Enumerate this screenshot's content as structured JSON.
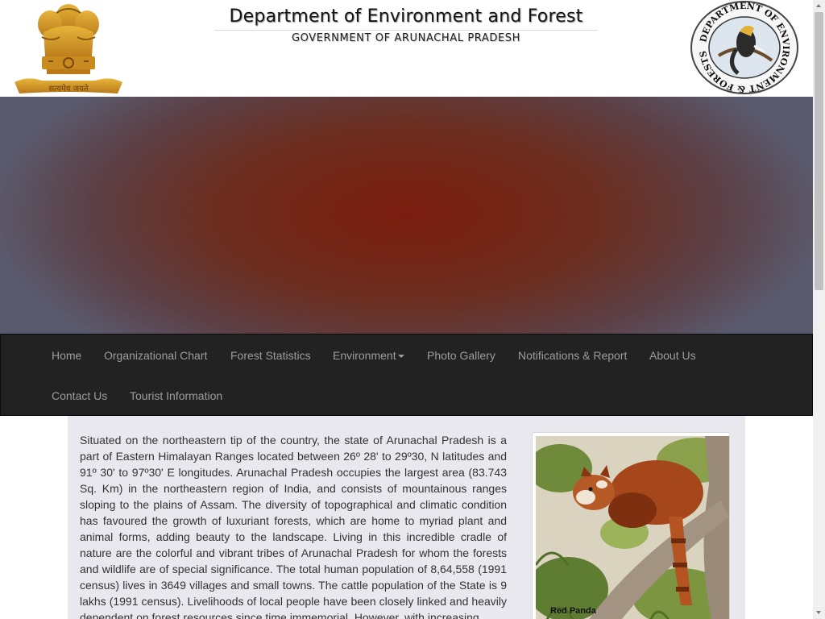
{
  "header": {
    "title": "Department of Environment and Forest",
    "subtitle": "GOVERNMENT OF ARUNACHAL PRADESH",
    "emblem_text": "सत्यमेव जयते",
    "seal_text": "DEPARTMENT OF ENVIRONMENT & FORESTS (AP)"
  },
  "nav": {
    "items": [
      {
        "label": "Home"
      },
      {
        "label": "Organizational Chart"
      },
      {
        "label": "Forest Statistics"
      },
      {
        "label": "Environment"
      },
      {
        "label": "Photo Gallery"
      },
      {
        "label": "Notifications & Report"
      },
      {
        "label": "About Us"
      },
      {
        "label": "Contact Us"
      },
      {
        "label": "Tourist Information"
      }
    ]
  },
  "content": {
    "intro": "Situated on the northeastern tip of the country, the state of Arunachal Pradesh is a part of Eastern Himalayan Ranges located between 26º 28' to 29º30, N latitudes and 91º 30' to 97º30' E longitudes. Arunachal Pradesh occupies the largest area (83.743 Sq. Km) in the northeastern region of India, and consists of mountainous ranges sloping to the plains of Assam. The diversity of topographical and climatic condition has favoured the growth of luxuriant forests, which are home to myriad plant and animal forms, adding beauty to the landscape. Living in this incredible cradle of nature are the colorful and vibrant tribes of Arunachal Pradesh for whom the forests and wildlife are of special significance. The total human population of 8,64,558 (1991 census) lives in 3649 villages and small towns. The cattle population of the State is 9 lakhs (1991 census). Livelihoods of local people have been closely linked and heavily dependent on forest resources since time immemorial. However, with increasing",
    "photo_caption": "Red Panda"
  },
  "colors": {
    "navbar_bg": "#222222",
    "nav_text": "#9d9d9d",
    "content_bg": "#e8e8ee",
    "banner_center": "#7a1d0f"
  }
}
